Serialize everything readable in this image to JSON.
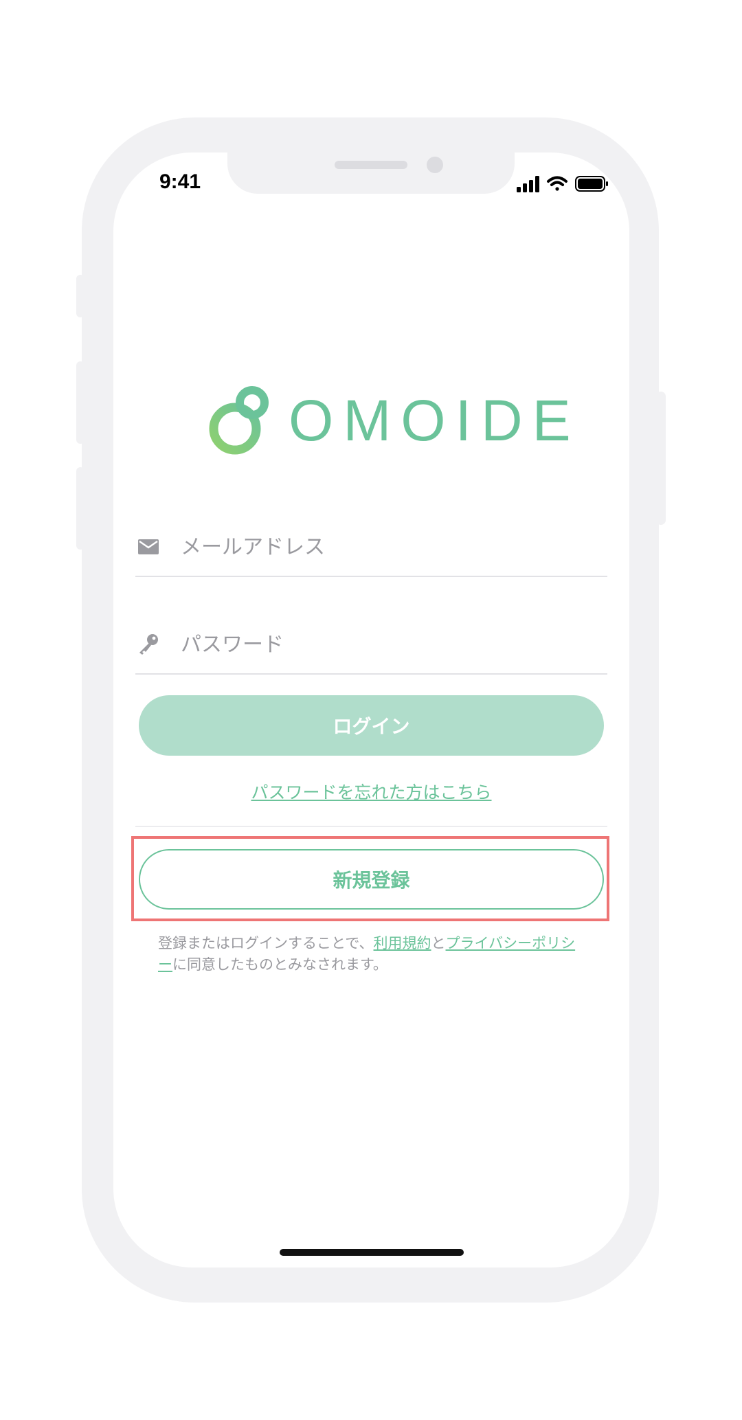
{
  "status_bar": {
    "time": "9:41",
    "icons": [
      "cellular-signal-icon",
      "wifi-icon",
      "battery-icon"
    ]
  },
  "logo": {
    "text": "OMOIDE",
    "icon": "linked-rings-logo-icon"
  },
  "form": {
    "email": {
      "icon": "mail-icon",
      "placeholder": "メールアドレス",
      "value": ""
    },
    "password": {
      "icon": "key-icon",
      "placeholder": "パスワード",
      "value": ""
    },
    "login_label": "ログイン",
    "forgot_password_label": "パスワードを忘れた方はこちら"
  },
  "register": {
    "label": "新規登録"
  },
  "terms": {
    "prefix": "登録またはログインすることで、",
    "terms_link": "利用規約",
    "middle": "と",
    "privacy_link": "プライバシーポリシー",
    "suffix": "に同意したものとみなされます。"
  },
  "colors": {
    "accent": "#6bc39a",
    "login_button_bg": "#b0ddcb",
    "highlight_border": "#ee7575",
    "placeholder": "#9a9a9f",
    "phone_frame": "#f1f1f3"
  }
}
